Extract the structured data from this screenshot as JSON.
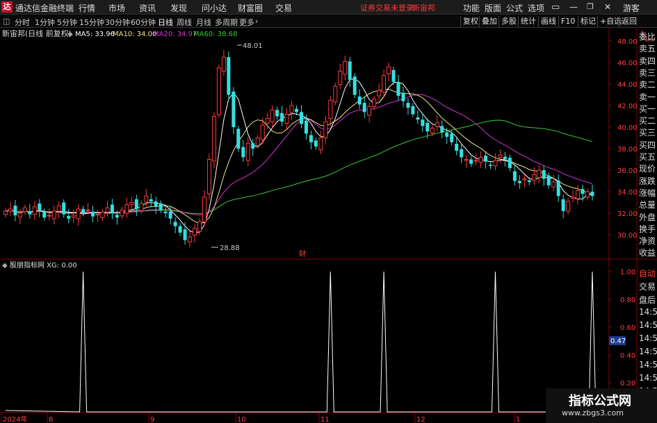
{
  "app": {
    "title": "通达信金融终端",
    "menus": [
      "行情",
      "市场",
      "资讯",
      "发现",
      "问小达",
      "财富圈",
      "交易"
    ],
    "notice": "证券交易未登录",
    "stock_short": "新宙邦",
    "right_menus": [
      "功能",
      "版面",
      "公式",
      "选项"
    ],
    "user": "游客"
  },
  "toolbar": {
    "periods": [
      "分时",
      "1分钟",
      "5分钟",
      "15分钟",
      "30分钟",
      "60分钟",
      "日线",
      "周线",
      "月线",
      "多周期",
      "更多"
    ],
    "active": "日线",
    "right_buttons": [
      "复权",
      "叠加",
      "多股",
      "统计",
      "画线",
      "F10",
      "标记",
      "+自选",
      "返回"
    ]
  },
  "main_chart": {
    "stock_label": "新宙邦(日线 前复权)",
    "ma": [
      {
        "label": "MA5: 33.96",
        "color": "#ffffff"
      },
      {
        "label": "MA10: 34.00",
        "color": "#f0e68c"
      },
      {
        "label": "MA20: 34.97",
        "color": "#d633d6"
      },
      {
        "label": "MA60: 38.68",
        "color": "#33cc33"
      }
    ],
    "price_axis": [
      "48.00",
      "46.00",
      "44.00",
      "42.00",
      "40.00",
      "38.00",
      "36.00",
      "34.00",
      "32.00",
      "30.00"
    ],
    "high_label": "48.01",
    "low_label": "28.88",
    "finance_tag": "财",
    "corner_label": "L",
    "corner_sub": "500"
  },
  "side_panel": [
    "委比",
    "卖五",
    "卖四",
    "卖三",
    "卖二",
    "卖一",
    "买一",
    "买二",
    "买三",
    "买四",
    "买五",
    "现价",
    "涨跌",
    "涨幅",
    "总量",
    "外盘",
    "换手",
    "净资",
    "收益"
  ],
  "indicator": {
    "title": "股朋指标网 XG: 0.00",
    "axis": [
      "1.00",
      "0.80",
      "0.60",
      "0.40",
      "0.20"
    ],
    "current": "0.47",
    "side": [
      "自动",
      "交易",
      "盘后",
      "14:56",
      "14:56",
      "14:56",
      "14:56",
      "14:56",
      "14:56",
      "14:56"
    ]
  },
  "date_axis": [
    "2024年",
    "8",
    "9",
    "10",
    "11",
    "12",
    "1"
  ],
  "watermark": {
    "line1": "指标公式网",
    "line2": "www.zbgs3.com"
  },
  "chart_data": {
    "type": "line",
    "title": "新宙邦(日线 前复权)",
    "ylim": [
      28,
      49
    ],
    "series_ohlc_close": [
      32.2,
      32.4,
      31.8,
      32.0,
      32.5,
      31.9,
      32.6,
      32.3,
      31.6,
      31.8,
      32.2,
      32.7,
      31.9,
      31.5,
      31.8,
      32.4,
      32.0,
      32.3,
      31.7,
      31.9,
      32.1,
      32.5,
      32.0,
      31.6,
      32.3,
      32.8,
      33.0,
      32.4,
      32.9,
      33.6,
      33.1,
      32.6,
      32.3,
      32.0,
      31.5,
      30.8,
      30.2,
      29.5,
      29.8,
      30.6,
      31.2,
      33.5,
      37.0,
      41.0,
      45.5,
      46.5,
      43.0,
      40.0,
      38.0,
      37.2,
      38.5,
      38.0,
      39.0,
      40.2,
      40.8,
      41.6,
      41.0,
      40.5,
      41.2,
      42.0,
      41.4,
      40.3,
      39.4,
      38.6,
      38.2,
      39.0,
      40.5,
      42.5,
      43.8,
      45.2,
      46.1,
      44.4,
      43.0,
      42.1,
      41.4,
      41.9,
      42.6,
      43.4,
      44.8,
      45.6,
      44.2,
      42.9,
      42.4,
      41.8,
      41.2,
      40.7,
      40.1,
      39.6,
      39.9,
      40.4,
      39.5,
      39.1,
      38.6,
      37.8,
      37.2,
      37.0,
      36.6,
      36.9,
      37.2,
      36.8,
      36.4,
      36.9,
      37.4,
      37.0,
      36.2,
      35.0,
      34.8,
      35.2,
      34.9,
      35.6,
      36.0,
      35.2,
      34.6,
      34.9,
      33.6,
      32.2,
      33.1,
      33.5,
      34.1,
      33.8,
      34.0,
      33.6
    ]
  },
  "indicator_data": {
    "type": "line",
    "series": [
      {
        "name": "XG",
        "spikes_at_index": [
          16,
          67,
          78,
          101,
          121
        ]
      }
    ]
  }
}
